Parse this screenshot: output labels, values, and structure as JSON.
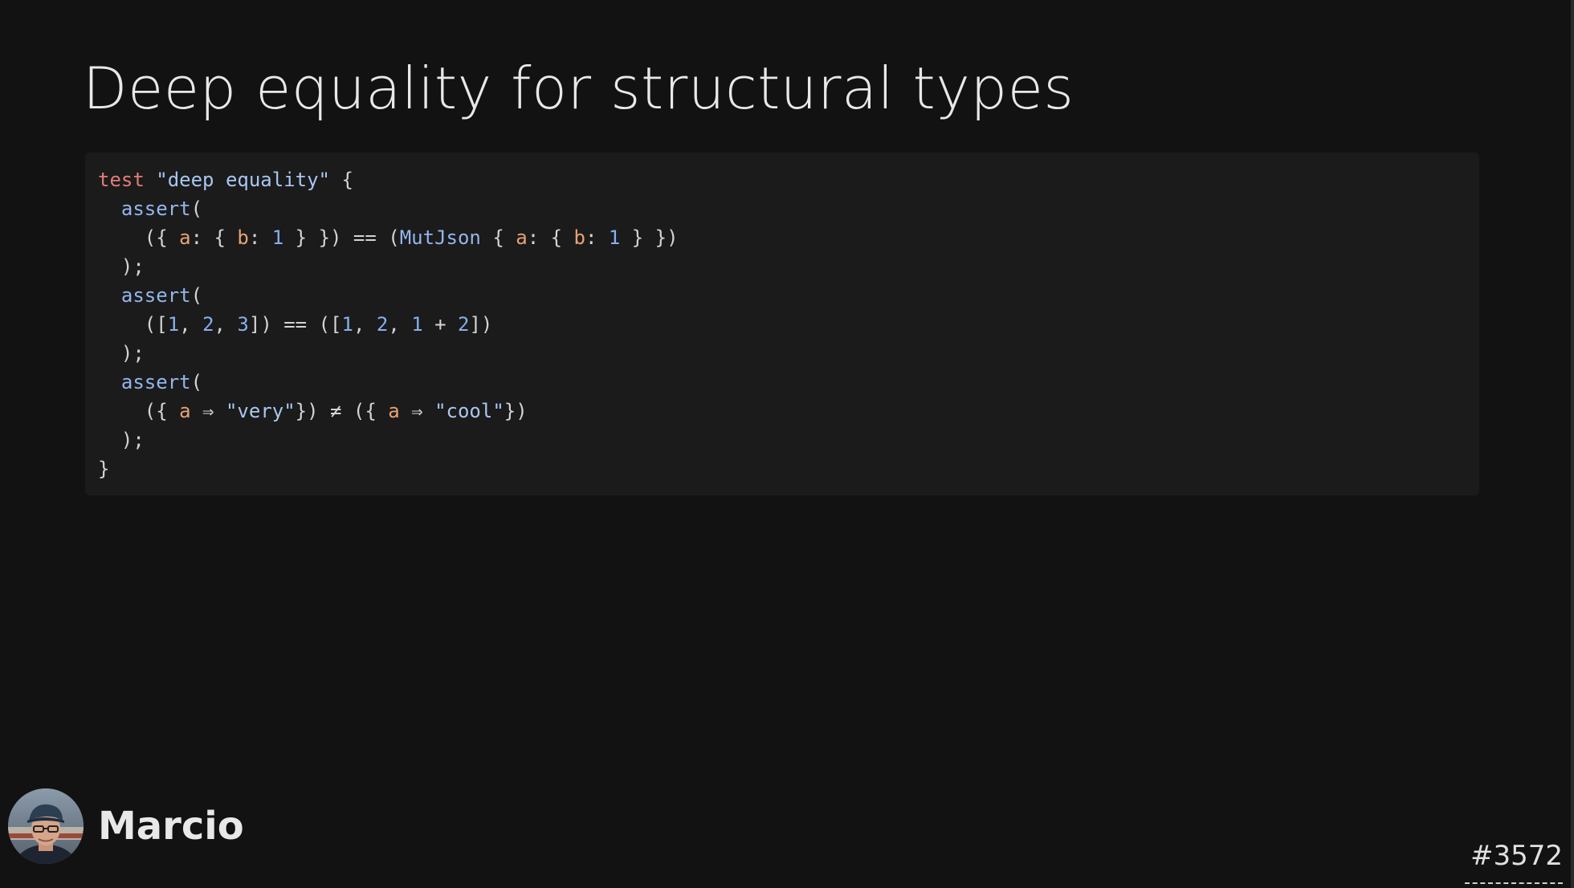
{
  "slide": {
    "title": "Deep equality for structural types",
    "presenter": {
      "name": "Marcio",
      "avatar_icon": "presenter-avatar-photo"
    },
    "slide_number": "#3572"
  },
  "code": {
    "lines": [
      [
        {
          "t": "test",
          "c": "kw"
        },
        {
          "t": " ",
          "c": "punc"
        },
        {
          "t": "\"deep equality\"",
          "c": "str"
        },
        {
          "t": " {",
          "c": "punc"
        }
      ],
      [
        {
          "t": "  ",
          "c": "punc"
        },
        {
          "t": "assert",
          "c": "fn"
        },
        {
          "t": "(",
          "c": "punc"
        }
      ],
      [
        {
          "t": "    ({ ",
          "c": "punc"
        },
        {
          "t": "a",
          "c": "prop"
        },
        {
          "t": ": { ",
          "c": "punc"
        },
        {
          "t": "b",
          "c": "prop"
        },
        {
          "t": ": ",
          "c": "punc"
        },
        {
          "t": "1",
          "c": "num"
        },
        {
          "t": " } }) ",
          "c": "punc"
        },
        {
          "t": "==",
          "c": "punc"
        },
        {
          "t": " (",
          "c": "punc"
        },
        {
          "t": "MutJson",
          "c": "type"
        },
        {
          "t": " { ",
          "c": "punc"
        },
        {
          "t": "a",
          "c": "prop"
        },
        {
          "t": ": { ",
          "c": "punc"
        },
        {
          "t": "b",
          "c": "prop"
        },
        {
          "t": ": ",
          "c": "punc"
        },
        {
          "t": "1",
          "c": "num"
        },
        {
          "t": " } })",
          "c": "punc"
        }
      ],
      [
        {
          "t": "  );",
          "c": "punc"
        }
      ],
      [
        {
          "t": "  ",
          "c": "punc"
        },
        {
          "t": "assert",
          "c": "fn"
        },
        {
          "t": "(",
          "c": "punc"
        }
      ],
      [
        {
          "t": "    ([",
          "c": "punc"
        },
        {
          "t": "1",
          "c": "num"
        },
        {
          "t": ", ",
          "c": "punc"
        },
        {
          "t": "2",
          "c": "num"
        },
        {
          "t": ", ",
          "c": "punc"
        },
        {
          "t": "3",
          "c": "num"
        },
        {
          "t": "]) ",
          "c": "punc"
        },
        {
          "t": "==",
          "c": "punc"
        },
        {
          "t": " ([",
          "c": "punc"
        },
        {
          "t": "1",
          "c": "num"
        },
        {
          "t": ", ",
          "c": "punc"
        },
        {
          "t": "2",
          "c": "num"
        },
        {
          "t": ", ",
          "c": "punc"
        },
        {
          "t": "1",
          "c": "num"
        },
        {
          "t": " + ",
          "c": "punc"
        },
        {
          "t": "2",
          "c": "num"
        },
        {
          "t": "])",
          "c": "punc"
        }
      ],
      [
        {
          "t": "  );",
          "c": "punc"
        }
      ],
      [
        {
          "t": "  ",
          "c": "punc"
        },
        {
          "t": "assert",
          "c": "fn"
        },
        {
          "t": "(",
          "c": "punc"
        }
      ],
      [
        {
          "t": "    ({ ",
          "c": "punc"
        },
        {
          "t": "a",
          "c": "prop"
        },
        {
          "t": " ⇒ ",
          "c": "punc"
        },
        {
          "t": "\"very\"",
          "c": "str"
        },
        {
          "t": "}) ≠ ({ ",
          "c": "punc"
        },
        {
          "t": "a",
          "c": "prop"
        },
        {
          "t": " ⇒ ",
          "c": "punc"
        },
        {
          "t": "\"cool\"",
          "c": "str"
        },
        {
          "t": "})",
          "c": "punc"
        }
      ],
      [
        {
          "t": "  );",
          "c": "punc"
        }
      ],
      [
        {
          "t": "}",
          "c": "punc"
        }
      ]
    ]
  },
  "colors": {
    "background": "#121212",
    "code_background": "#1b1b1b",
    "keyword": "#e27d76",
    "string": "#a9c7f0",
    "function": "#93b6ec",
    "property": "#e7a372",
    "number": "#86b0ee"
  }
}
